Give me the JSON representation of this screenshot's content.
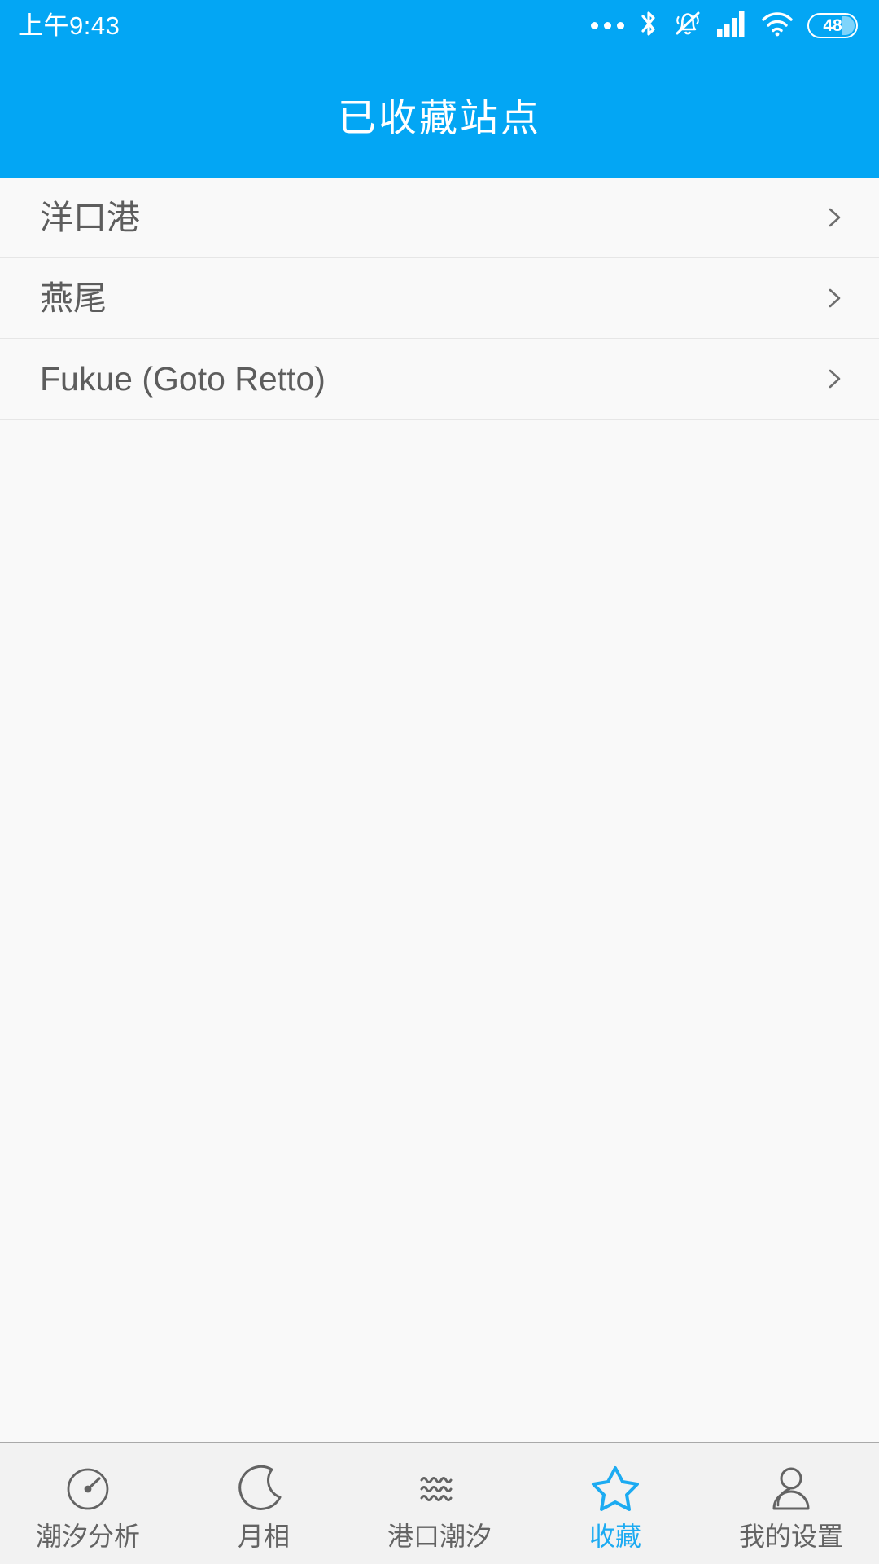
{
  "theme": {
    "accent": "#03a6f4",
    "accent_active": "#1cabf2",
    "page_bg": "#f9f9f9",
    "tabbar_bg": "#f2f2f2",
    "text_primary": "#5d5d5d",
    "text_tab": "#636363",
    "divider": "#e6e6e6"
  },
  "statusbar": {
    "time": "上午9:43",
    "battery_level": "48",
    "icons": [
      {
        "name": "more-dots-icon"
      },
      {
        "name": "bluetooth-icon"
      },
      {
        "name": "bell-muted-icon"
      },
      {
        "name": "signal-bars-icon"
      },
      {
        "name": "wifi-icon"
      },
      {
        "name": "battery-icon"
      }
    ]
  },
  "header": {
    "title": "已收藏站点"
  },
  "list": {
    "items": [
      {
        "label": "洋口港",
        "chevron": "chevron-right-icon"
      },
      {
        "label": "燕尾",
        "chevron": "chevron-right-icon"
      },
      {
        "label": "Fukue (Goto Retto)",
        "chevron": "chevron-right-icon"
      }
    ]
  },
  "tabbar": {
    "active_index": 3,
    "tabs": [
      {
        "label": "潮汐分析",
        "icon": "gauge-icon"
      },
      {
        "label": "月相",
        "icon": "moon-icon"
      },
      {
        "label": "港口潮汐",
        "icon": "waves-icon"
      },
      {
        "label": "收藏",
        "icon": "star-icon"
      },
      {
        "label": "我的设置",
        "icon": "person-icon"
      }
    ]
  }
}
